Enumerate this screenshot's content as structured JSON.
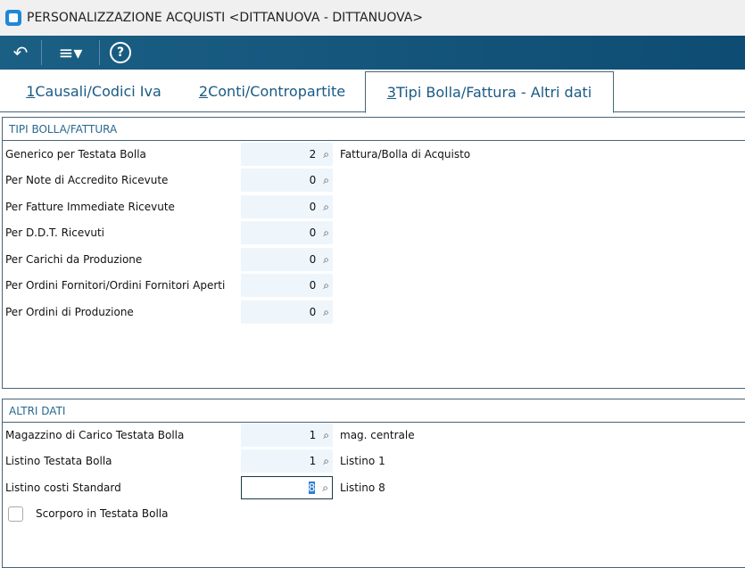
{
  "window": {
    "title": "PERSONALIZZAZIONE ACQUISTI <DITTANUOVA - DITTANUOVA>"
  },
  "toolbar": {
    "back": "↶",
    "menu": "≡▾",
    "help": "?"
  },
  "tabs": [
    {
      "num": "1",
      "label": " Causali/Codici Iva"
    },
    {
      "num": "2",
      "label": " Conti/Contropartite"
    },
    {
      "num": "3",
      "label": " Tipi Bolla/Fattura - Altri dati"
    }
  ],
  "tipi": {
    "title": "TIPI BOLLA/FATTURA",
    "rows": [
      {
        "label": "Generico per Testata Bolla",
        "value": "2",
        "desc": "Fattura/Bolla di Acquisto"
      },
      {
        "label": "Per Note di Accredito Ricevute",
        "value": "0",
        "desc": ""
      },
      {
        "label": "Per Fatture Immediate Ricevute",
        "value": "0",
        "desc": ""
      },
      {
        "label": "Per D.D.T. Ricevuti",
        "value": "0",
        "desc": ""
      },
      {
        "label": "Per Carichi da Produzione",
        "value": "0",
        "desc": ""
      },
      {
        "label": "Per Ordini Fornitori/Ordini Fornitori Aperti",
        "value": "0",
        "desc": ""
      },
      {
        "label": "Per Ordini di Produzione",
        "value": "0",
        "desc": ""
      }
    ]
  },
  "altri": {
    "title": "ALTRI DATI",
    "rows": [
      {
        "label": "Magazzino di Carico Testata Bolla",
        "value": "1",
        "desc": "mag. centrale"
      },
      {
        "label": "Listino Testata Bolla",
        "value": "1",
        "desc": "Listino 1"
      },
      {
        "label": "Listino costi Standard",
        "value": "8",
        "desc": "Listino 8"
      }
    ],
    "checkbox": {
      "label": "Scorporo in Testata Bolla",
      "checked": false
    }
  }
}
